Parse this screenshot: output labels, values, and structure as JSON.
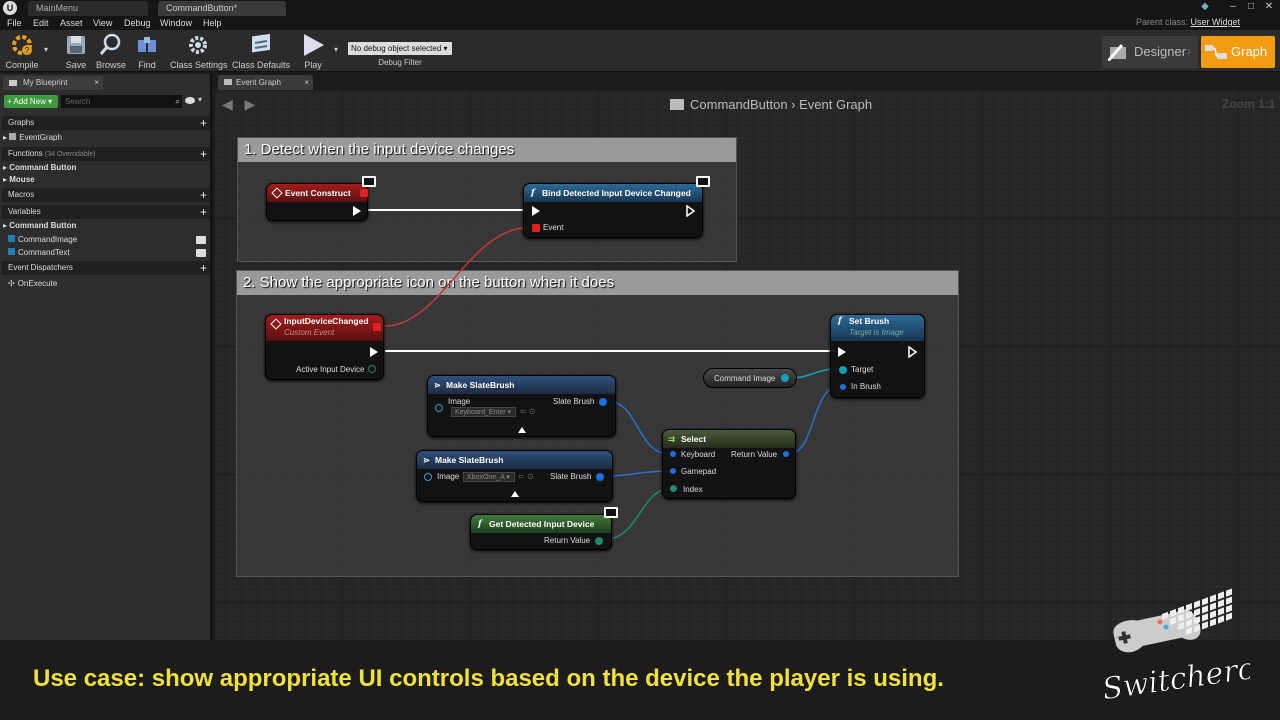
{
  "titlebar": {
    "tabs": [
      "MainMenu",
      "CommandButton*"
    ]
  },
  "menu": [
    "File",
    "Edit",
    "Asset",
    "View",
    "Debug",
    "Window",
    "Help"
  ],
  "parent_class": {
    "label": "Parent class:",
    "value": "User Widget"
  },
  "toolbar": {
    "compile": "Compile",
    "save": "Save",
    "browse": "Browse",
    "find": "Find",
    "class_settings": "Class Settings",
    "class_defaults": "Class Defaults",
    "play": "Play",
    "debug_select": "No debug object selected",
    "debug_filter": "Debug Filter",
    "designer": "Designer",
    "graph": "Graph"
  },
  "left_panel": {
    "tab": "My Blueprint",
    "add_new": "Add New",
    "search_placeholder": "Search",
    "graphs_header": "Graphs",
    "event_graph": "EventGraph",
    "functions_header": "Functions",
    "functions_count": "(34 Overridable)",
    "functions": [
      "Command Button",
      "Mouse"
    ],
    "macros_header": "Macros",
    "variables_header": "Variables",
    "variables_category": "Command Button",
    "variables": [
      "CommandImage",
      "CommandText"
    ],
    "dispatchers_header": "Event Dispatchers",
    "dispatchers": [
      "OnExecute"
    ]
  },
  "graph": {
    "tab": "Event Graph",
    "breadcrumb_root": "CommandButton",
    "breadcrumb_leaf": "Event Graph",
    "zoom": "Zoom 1:1",
    "comment1": "1. Detect when the input device changes",
    "comment2": "2. Show the appropriate icon on the button when it does",
    "nodes": {
      "event_construct": "Event Construct",
      "bind_detected": "Bind Detected Input Device Changed",
      "bind_event_pin": "Event",
      "input_changed": "InputDeviceChanged",
      "input_changed_sub": "Custom Event",
      "active_input": "Active Input Device",
      "make_brush": "Make SlateBrush",
      "image_pin": "Image",
      "slate_brush_pin": "Slate Brush",
      "keyboard_combo": "Keyboard_Enter",
      "xbox_combo": "XboxOne_A",
      "select": "Select",
      "keyboard_pin": "Keyboard",
      "gamepad_pin": "Gamepad",
      "index_pin": "Index",
      "return_value": "Return Value",
      "get_detected": "Get Detected Input Device",
      "command_image": "Command Image",
      "set_brush": "Set Brush",
      "set_brush_sub": "Target is Image",
      "target_pin": "Target",
      "in_brush_pin": "In Brush"
    }
  },
  "caption": "Use case: show appropriate UI controls based on the device the player is using.",
  "brand": "Switcheroo",
  "colors": {
    "graph_button": "#f39c12",
    "caption": "#f2e13a",
    "event_header": "#a31c1c",
    "function_header": "#2d6a96",
    "pure_header": "#3e7a3a"
  }
}
